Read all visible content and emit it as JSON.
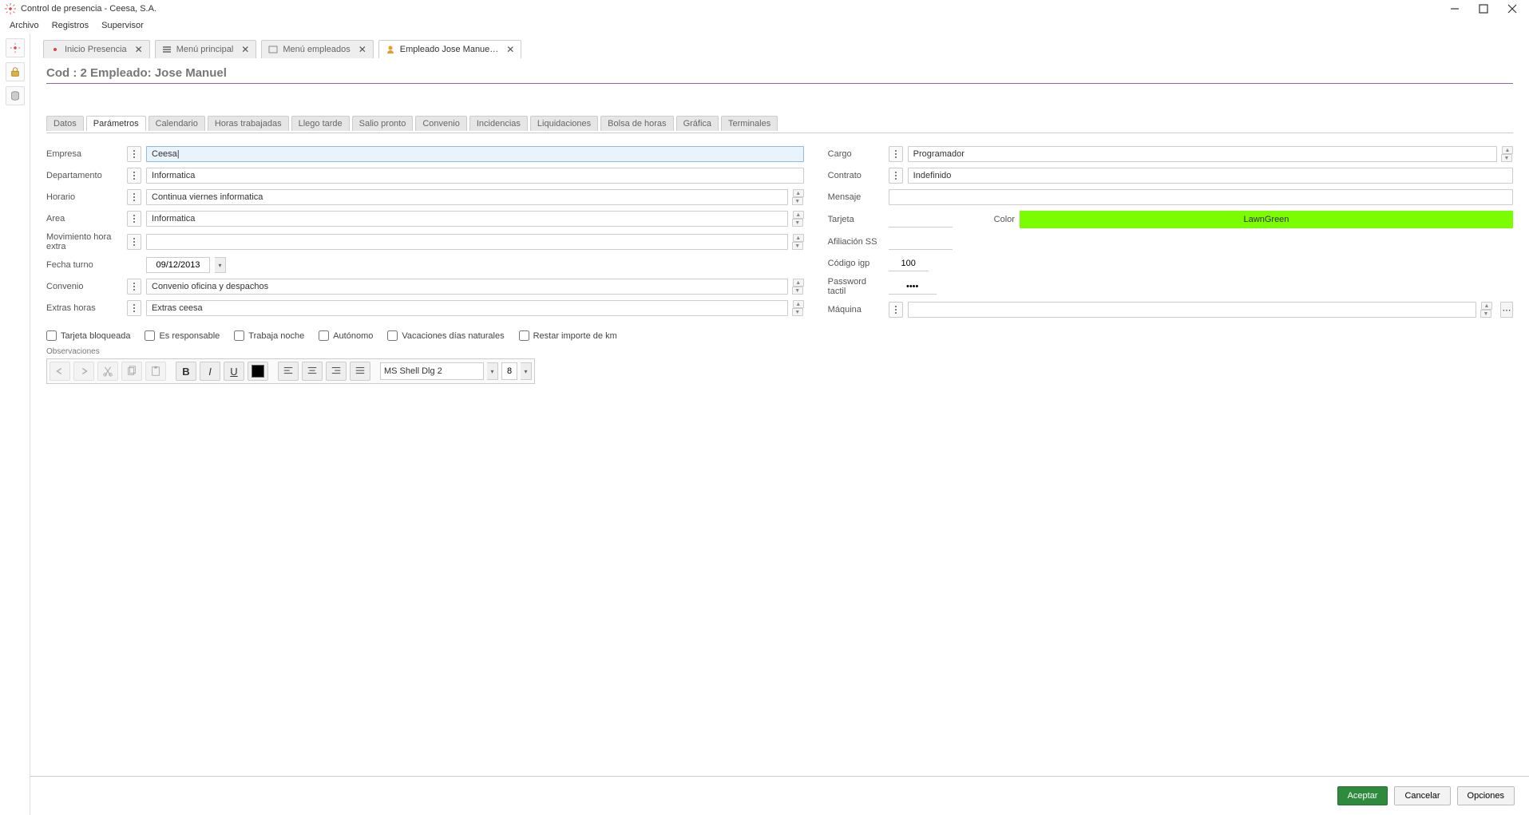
{
  "window": {
    "title": "Control de presencia - Ceesa, S.A."
  },
  "menu": [
    "Archivo",
    "Registros",
    "Supervisor"
  ],
  "tabs": [
    {
      "label": "Inicio Presencia",
      "closable": true,
      "active": false
    },
    {
      "label": "Menú principal",
      "closable": true,
      "active": false
    },
    {
      "label": "Menú empleados",
      "closable": true,
      "active": false
    },
    {
      "label": "Empleado  Jose Manue…",
      "closable": true,
      "active": true
    }
  ],
  "page_title": "Cod : 2 Empleado: Jose Manuel",
  "subtabs": [
    "Datos",
    "Parámetros",
    "Calendario",
    "Horas trabajadas",
    "Llego tarde",
    "Salio pronto",
    "Convenio",
    "Incidencias",
    "Liquidaciones",
    "Bolsa de horas",
    "Gráfica",
    "Terminales"
  ],
  "subtab_active_index": 1,
  "fields": {
    "left": {
      "empresa": {
        "label": "Empresa",
        "value": "Ceesa|"
      },
      "departamento": {
        "label": "Departamento",
        "value": "Informatica"
      },
      "horario": {
        "label": "Horario",
        "value": "Continua viernes informatica"
      },
      "area": {
        "label": "Area",
        "value": "Informatica"
      },
      "mov_extra": {
        "label": "Movimiento hora extra",
        "value": ""
      },
      "fecha_turno": {
        "label": "Fecha turno",
        "value": "09/12/2013"
      },
      "convenio": {
        "label": "Convenio",
        "value": "Convenio oficina y despachos"
      },
      "extras_horas": {
        "label": "Extras horas",
        "value": "Extras ceesa"
      }
    },
    "right": {
      "cargo": {
        "label": "Cargo",
        "value": "Programador"
      },
      "contrato": {
        "label": "Contrato",
        "value": "Indefinido"
      },
      "mensaje": {
        "label": "Mensaje",
        "value": ""
      },
      "tarjeta": {
        "label": "Tarjeta",
        "value": ""
      },
      "color": {
        "label": "Color",
        "value": "LawnGreen",
        "hex": "#7CFC00"
      },
      "afiliacion_ss": {
        "label": "Afiliación SS",
        "value": ""
      },
      "codigo_igp": {
        "label": "Código igp",
        "value": "100"
      },
      "password": {
        "label": "Password tactil",
        "value": "••••"
      },
      "maquina": {
        "label": "Máquina",
        "value": ""
      }
    }
  },
  "checks": {
    "tarjeta_bloqueada": "Tarjeta bloqueada",
    "es_responsable": "Es responsable",
    "trabaja_noche": "Trabaja noche",
    "autonomo": "Autónomo",
    "vacaciones_dias_naturales": "Vacaciones días naturales",
    "restar_km": "Restar importe de km"
  },
  "observaciones": {
    "label": "Observaciones",
    "font": "MS Shell Dlg 2",
    "size": "8"
  },
  "footer": {
    "aceptar": "Aceptar",
    "cancelar": "Cancelar",
    "opciones": "Opciones"
  }
}
